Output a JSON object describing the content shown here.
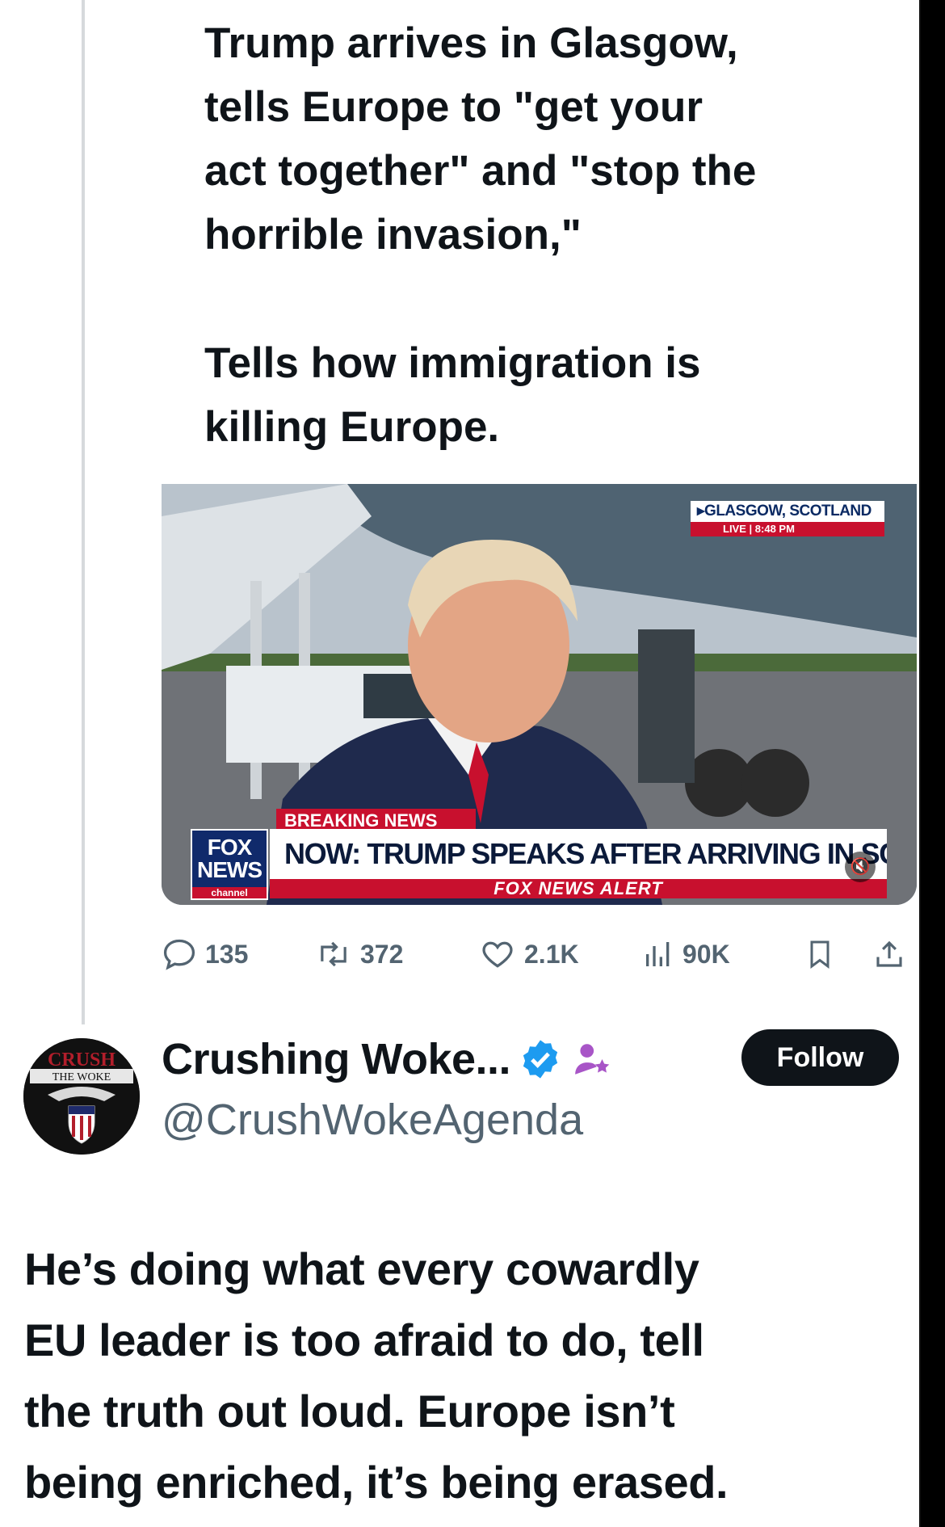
{
  "quoted_post": {
    "text_line1": "Trump arrives in Glasgow,",
    "text_line2": "tells Europe to \"get your",
    "text_line3": "act together\" and \"stop the",
    "text_line4": "horrible invasion,\"",
    "text_line5": "Tells how immigration is",
    "text_line6": "killing Europe."
  },
  "media": {
    "location": "GLASGOW, SCOTLAND",
    "live_label": "LIVE",
    "time": "8:48 PM",
    "breaking_label_a": "BREAKING",
    "breaking_label_b": "NEWS",
    "logo_line1": "FOX",
    "logo_line2": "NEWS",
    "logo_line3": "channel",
    "ticker": "NOW: TRUMP SPEAKS AFTER ARRIVING IN SCOTLAND",
    "alert": "FOX NEWS ALERT"
  },
  "actions": {
    "replies": "135",
    "reposts": "372",
    "likes": "2.1K",
    "views": "90K"
  },
  "reply_post": {
    "avatar_text_top": "CRUSH",
    "avatar_text_band": "THE WOKE",
    "display_name": "Crushing Woke...",
    "handle": "@CrushWokeAgenda",
    "follow_label": "Follow",
    "text_line1": "He’s doing what every cowardly",
    "text_line2": "EU leader is too afraid to do, tell",
    "text_line3": "the truth out loud. Europe isn’t",
    "text_line4": "being enriched, it’s being erased."
  },
  "colors": {
    "text_primary": "#0f1419",
    "text_secondary": "#536471",
    "verified_blue": "#1d9bf0",
    "fox_red": "#c8102e",
    "fox_navy": "#102a6b"
  }
}
